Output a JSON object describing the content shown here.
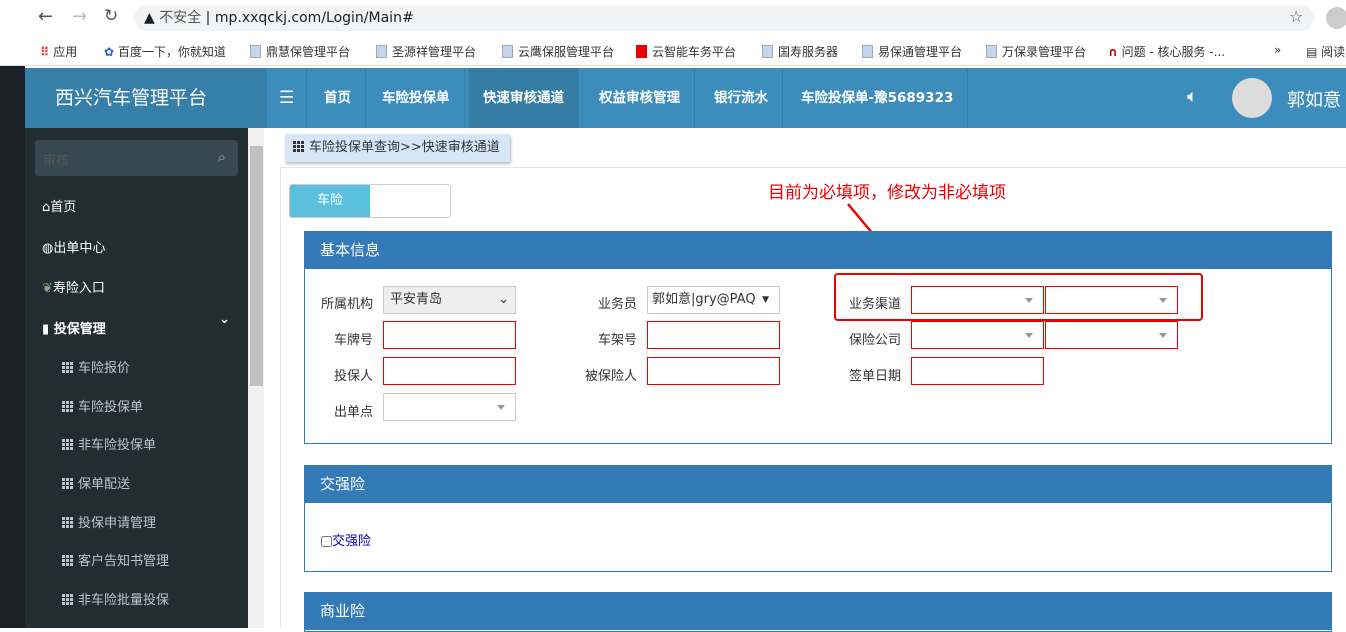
{
  "browser": {
    "security": "不安全",
    "url": "mp.xxqckj.com/Login/Main#",
    "bookmarks": [
      "应用",
      "百度一下，你就知道",
      "鼎慧保管理平台",
      "圣源祥管理平台",
      "云鹰保服管理平台",
      "云智能车务平台",
      "国寿服务器",
      "易保通管理平台",
      "万保录管理平台",
      "问题 - 核心服务 -...",
      "阅读"
    ]
  },
  "app": {
    "title": "西兴汽车管理平台",
    "nav": [
      "首页",
      "车险投保单",
      "快速审核通道",
      "权益审核管理",
      "银行流水",
      "车险投保单-豫5689323"
    ],
    "user": "郭如意"
  },
  "sidebar": {
    "search_placeholder": "审核",
    "items": [
      "首页",
      "出单中心",
      "寿险入口",
      "投保管理"
    ],
    "sub_items": [
      "车险报价",
      "车险投保单",
      "非车险投保单",
      "保单配送",
      "投保申请管理",
      "客户告知书管理",
      "非车险批量投保"
    ]
  },
  "breadcrumb": "车险投保单查询>>快速审核通道",
  "tab": "车险",
  "annotation": "目前为必填项，修改为非必填项",
  "basic": {
    "title": "基本信息",
    "labels": [
      "所属机构",
      "业务员",
      "业务渠道",
      "车牌号",
      "车架号",
      "保险公司",
      "投保人",
      "被保险人",
      "签单日期",
      "出单点"
    ],
    "org_value": "平安青岛",
    "salesman_value": "郭如意|gry@PAQ"
  },
  "jqx": {
    "title": "交强险",
    "checkbox_label": "交强险"
  },
  "syx": {
    "title": "商业险"
  },
  "colors": {
    "header": "#3c8dbc",
    "sidebar": "#222d32",
    "panel": "#337ab7",
    "required": "#ee0000"
  }
}
